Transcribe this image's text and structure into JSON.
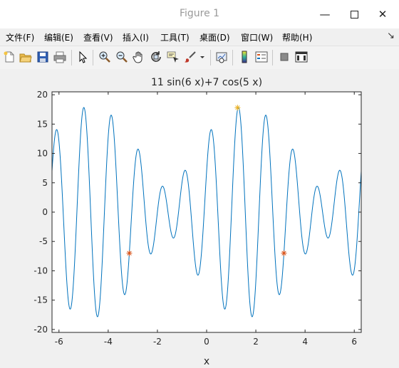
{
  "window": {
    "title": "Figure 1"
  },
  "menu": [
    {
      "label": "文件(F)",
      "name": "menu-file"
    },
    {
      "label": "编辑(E)",
      "name": "menu-edit"
    },
    {
      "label": "查看(V)",
      "name": "menu-view"
    },
    {
      "label": "插入(I)",
      "name": "menu-insert"
    },
    {
      "label": "工具(T)",
      "name": "menu-tools"
    },
    {
      "label": "桌面(D)",
      "name": "menu-desktop"
    },
    {
      "label": "窗口(W)",
      "name": "menu-window"
    },
    {
      "label": "帮助(H)",
      "name": "menu-help"
    }
  ],
  "toolbar_icons": [
    "new-figure-icon",
    "open-file-icon",
    "save-icon",
    "print-icon",
    "pointer-icon",
    "zoom-in-icon",
    "zoom-out-icon",
    "pan-hand-icon",
    "rotate-3d-icon",
    "data-cursor-icon",
    "brush-icon",
    "dropdown-arrow-icon",
    "link-plot-icon",
    "colorbar-icon",
    "legend-icon",
    "hide-plot-tools-icon",
    "show-plot-tools-icon"
  ],
  "colors": {
    "line": "#0072BD",
    "red_markers": "#D95319",
    "yellow_marker": "#EDB120"
  },
  "chart_data": {
    "type": "line",
    "title": "11 sin(6 x)+7 cos(5 x)",
    "xlabel": "x",
    "ylabel": "",
    "xlim": [
      -6.2832,
      6.2832
    ],
    "ylim": [
      -20.5,
      20.5
    ],
    "x_ticks": [
      -6,
      -4,
      -2,
      0,
      2,
      4,
      6
    ],
    "y_ticks": [
      -20,
      -15,
      -10,
      -5,
      0,
      5,
      10,
      15,
      20
    ],
    "grid": false,
    "series": [
      {
        "function": "11*sin(6*x)+7*cos(5*x)",
        "x_range": [
          -6.2832,
          6.2832
        ],
        "color": "#0072BD"
      }
    ],
    "markers": [
      {
        "x": -3.1416,
        "y": -7,
        "symbol": "*",
        "color": "#D95319"
      },
      {
        "x": 3.1416,
        "y": -7,
        "symbol": "*",
        "color": "#D95319"
      },
      {
        "x": 1.2566,
        "y": 17.8,
        "symbol": "*",
        "color": "#EDB120"
      }
    ]
  }
}
